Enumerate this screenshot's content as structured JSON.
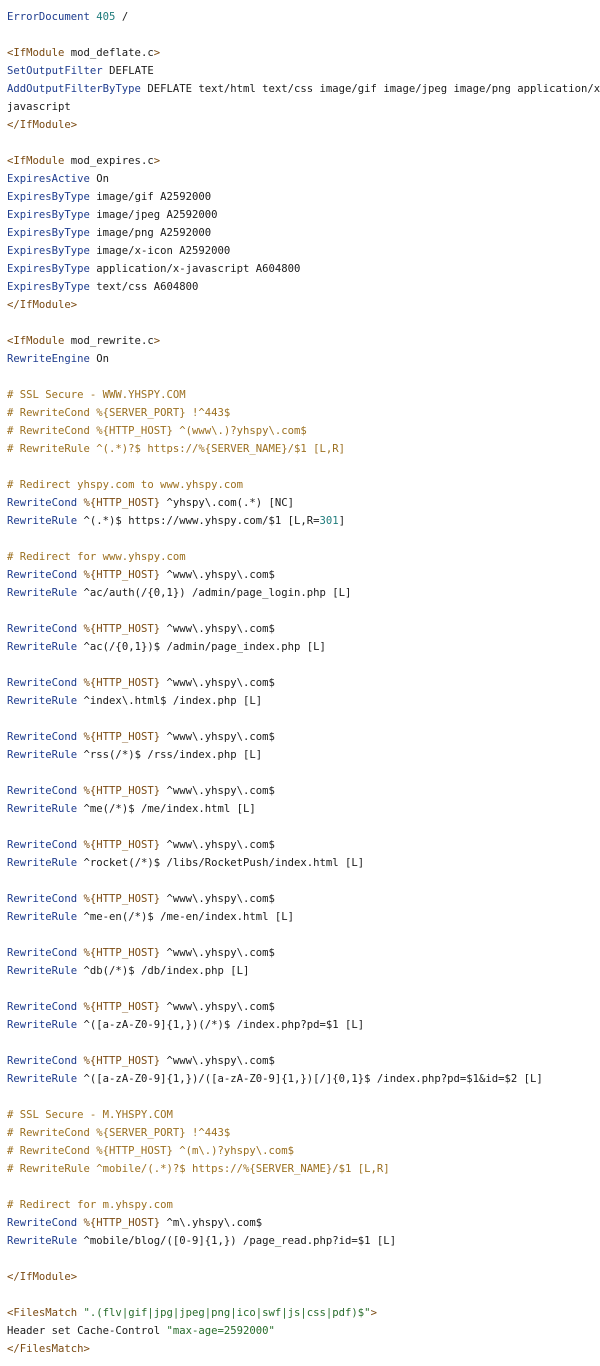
{
  "file": {
    "lines": [
      [
        {
          "t": "ErrorDocument ",
          "c": "directive"
        },
        {
          "t": "405",
          "c": "num"
        },
        {
          "t": " /",
          "c": "plain"
        }
      ],
      [],
      [
        {
          "t": "<IfModule ",
          "c": "tag"
        },
        {
          "t": "mod_deflate.c",
          "c": "plain"
        },
        {
          "t": ">",
          "c": "tag"
        }
      ],
      [
        {
          "t": "SetOutputFilter ",
          "c": "directive"
        },
        {
          "t": "DEFLATE",
          "c": "plain"
        }
      ],
      [
        {
          "t": "AddOutputFilterByType ",
          "c": "directive"
        },
        {
          "t": "DEFLATE text/html text/css image/gif image/jpeg image/png application/x-",
          "c": "plain"
        }
      ],
      [
        {
          "t": "javascript",
          "c": "plain"
        }
      ],
      [
        {
          "t": "</IfModule>",
          "c": "tag"
        }
      ],
      [],
      [
        {
          "t": "<IfModule ",
          "c": "tag"
        },
        {
          "t": "mod_expires.c",
          "c": "plain"
        },
        {
          "t": ">",
          "c": "tag"
        }
      ],
      [
        {
          "t": "ExpiresActive ",
          "c": "directive"
        },
        {
          "t": "On",
          "c": "plain"
        }
      ],
      [
        {
          "t": "ExpiresByType ",
          "c": "directive"
        },
        {
          "t": "image/gif A2592000",
          "c": "plain"
        }
      ],
      [
        {
          "t": "ExpiresByType ",
          "c": "directive"
        },
        {
          "t": "image/jpeg A2592000",
          "c": "plain"
        }
      ],
      [
        {
          "t": "ExpiresByType ",
          "c": "directive"
        },
        {
          "t": "image/png A2592000",
          "c": "plain"
        }
      ],
      [
        {
          "t": "ExpiresByType ",
          "c": "directive"
        },
        {
          "t": "image/x-icon A2592000",
          "c": "plain"
        }
      ],
      [
        {
          "t": "ExpiresByType ",
          "c": "directive"
        },
        {
          "t": "application/x-javascript A604800",
          "c": "plain"
        }
      ],
      [
        {
          "t": "ExpiresByType ",
          "c": "directive"
        },
        {
          "t": "text/css A604800",
          "c": "plain"
        }
      ],
      [
        {
          "t": "</IfModule>",
          "c": "tag"
        }
      ],
      [],
      [
        {
          "t": "<IfModule ",
          "c": "tag"
        },
        {
          "t": "mod_rewrite.c",
          "c": "plain"
        },
        {
          "t": ">",
          "c": "tag"
        }
      ],
      [
        {
          "t": "RewriteEngine ",
          "c": "directive"
        },
        {
          "t": "On",
          "c": "plain"
        }
      ],
      [],
      [
        {
          "t": "# SSL Secure - WWW.YHSPY.COM",
          "c": "comment"
        }
      ],
      [
        {
          "t": "# RewriteCond %{SERVER_PORT} !^443$",
          "c": "comment"
        }
      ],
      [
        {
          "t": "# RewriteCond %{HTTP_HOST} ^(www\\.)?yhspy\\.com$",
          "c": "comment"
        }
      ],
      [
        {
          "t": "# RewriteRule ^(.*)?$ https://%{SERVER_NAME}/$1 [L,R]",
          "c": "comment"
        }
      ],
      [],
      [
        {
          "t": "# Redirect yhspy.com to www.yhspy.com",
          "c": "comment"
        }
      ],
      [
        {
          "t": "RewriteCond ",
          "c": "directive"
        },
        {
          "t": "%{HTTP_HOST}",
          "c": "tag"
        },
        {
          "t": " ^yhspy\\.com(.*) [NC]",
          "c": "plain"
        }
      ],
      [
        {
          "t": "RewriteRule ",
          "c": "directive"
        },
        {
          "t": "^(.*)$ https://www.yhspy.com/$1 [L,R=",
          "c": "plain"
        },
        {
          "t": "301",
          "c": "num"
        },
        {
          "t": "]",
          "c": "plain"
        }
      ],
      [],
      [
        {
          "t": "# Redirect for www.yhspy.com",
          "c": "comment"
        }
      ],
      [
        {
          "t": "RewriteCond ",
          "c": "directive"
        },
        {
          "t": "%{HTTP_HOST}",
          "c": "tag"
        },
        {
          "t": " ^www\\.yhspy\\.com$",
          "c": "plain"
        }
      ],
      [
        {
          "t": "RewriteRule ",
          "c": "directive"
        },
        {
          "t": "^ac/auth(/{0,1}) /admin/page_login.php [L]",
          "c": "plain"
        }
      ],
      [],
      [
        {
          "t": "RewriteCond ",
          "c": "directive"
        },
        {
          "t": "%{HTTP_HOST}",
          "c": "tag"
        },
        {
          "t": " ^www\\.yhspy\\.com$",
          "c": "plain"
        }
      ],
      [
        {
          "t": "RewriteRule ",
          "c": "directive"
        },
        {
          "t": "^ac(/{0,1})$ /admin/page_index.php [L]",
          "c": "plain"
        }
      ],
      [],
      [
        {
          "t": "RewriteCond ",
          "c": "directive"
        },
        {
          "t": "%{HTTP_HOST}",
          "c": "tag"
        },
        {
          "t": " ^www\\.yhspy\\.com$",
          "c": "plain"
        }
      ],
      [
        {
          "t": "RewriteRule ",
          "c": "directive"
        },
        {
          "t": "^index\\.html$ /index.php [L]",
          "c": "plain"
        }
      ],
      [],
      [
        {
          "t": "RewriteCond ",
          "c": "directive"
        },
        {
          "t": "%{HTTP_HOST}",
          "c": "tag"
        },
        {
          "t": " ^www\\.yhspy\\.com$",
          "c": "plain"
        }
      ],
      [
        {
          "t": "RewriteRule ",
          "c": "directive"
        },
        {
          "t": "^rss(/*)$ /rss/index.php [L]",
          "c": "plain"
        }
      ],
      [],
      [
        {
          "t": "RewriteCond ",
          "c": "directive"
        },
        {
          "t": "%{HTTP_HOST}",
          "c": "tag"
        },
        {
          "t": " ^www\\.yhspy\\.com$",
          "c": "plain"
        }
      ],
      [
        {
          "t": "RewriteRule ",
          "c": "directive"
        },
        {
          "t": "^me(/*)$ /me/index.html [L]",
          "c": "plain"
        }
      ],
      [],
      [
        {
          "t": "RewriteCond ",
          "c": "directive"
        },
        {
          "t": "%{HTTP_HOST}",
          "c": "tag"
        },
        {
          "t": " ^www\\.yhspy\\.com$",
          "c": "plain"
        }
      ],
      [
        {
          "t": "RewriteRule ",
          "c": "directive"
        },
        {
          "t": "^rocket(/*)$ /libs/RocketPush/index.html [L]",
          "c": "plain"
        }
      ],
      [],
      [
        {
          "t": "RewriteCond ",
          "c": "directive"
        },
        {
          "t": "%{HTTP_HOST}",
          "c": "tag"
        },
        {
          "t": " ^www\\.yhspy\\.com$",
          "c": "plain"
        }
      ],
      [
        {
          "t": "RewriteRule ",
          "c": "directive"
        },
        {
          "t": "^me-en(/*)$ /me-en/index.html [L]",
          "c": "plain"
        }
      ],
      [],
      [
        {
          "t": "RewriteCond ",
          "c": "directive"
        },
        {
          "t": "%{HTTP_HOST}",
          "c": "tag"
        },
        {
          "t": " ^www\\.yhspy\\.com$",
          "c": "plain"
        }
      ],
      [
        {
          "t": "RewriteRule ",
          "c": "directive"
        },
        {
          "t": "^db(/*)$ /db/index.php [L]",
          "c": "plain"
        }
      ],
      [],
      [
        {
          "t": "RewriteCond ",
          "c": "directive"
        },
        {
          "t": "%{HTTP_HOST}",
          "c": "tag"
        },
        {
          "t": " ^www\\.yhspy\\.com$",
          "c": "plain"
        }
      ],
      [
        {
          "t": "RewriteRule ",
          "c": "directive"
        },
        {
          "t": "^([a-zA-Z0-9]{1,})(/*)$ /index.php?pd=$1 [L]",
          "c": "plain"
        }
      ],
      [],
      [
        {
          "t": "RewriteCond ",
          "c": "directive"
        },
        {
          "t": "%{HTTP_HOST}",
          "c": "tag"
        },
        {
          "t": " ^www\\.yhspy\\.com$",
          "c": "plain"
        }
      ],
      [
        {
          "t": "RewriteRule ",
          "c": "directive"
        },
        {
          "t": "^([a-zA-Z0-9]{1,})/([a-zA-Z0-9]{1,})[/]{0,1}$ /index.php?pd=$1&id=$2 [L]",
          "c": "plain"
        }
      ],
      [],
      [
        {
          "t": "# SSL Secure - M.YHSPY.COM",
          "c": "comment"
        }
      ],
      [
        {
          "t": "# RewriteCond %{SERVER_PORT} !^443$",
          "c": "comment"
        }
      ],
      [
        {
          "t": "# RewriteCond %{HTTP_HOST} ^(m\\.)?yhspy\\.com$",
          "c": "comment"
        }
      ],
      [
        {
          "t": "# RewriteRule ^mobile/(.*)?$ https://%{SERVER_NAME}/$1 [L,R]",
          "c": "comment"
        }
      ],
      [],
      [
        {
          "t": "# Redirect for m.yhspy.com",
          "c": "comment"
        }
      ],
      [
        {
          "t": "RewriteCond ",
          "c": "directive"
        },
        {
          "t": "%{HTTP_HOST}",
          "c": "tag"
        },
        {
          "t": " ^m\\.yhspy\\.com$",
          "c": "plain"
        }
      ],
      [
        {
          "t": "RewriteRule ",
          "c": "directive"
        },
        {
          "t": "^mobile/blog/([0-9]{1,}) /page_read.php?id=$1 [L]",
          "c": "plain"
        }
      ],
      [],
      [
        {
          "t": "</IfModule>",
          "c": "tag"
        }
      ],
      [],
      [
        {
          "t": "<FilesMatch ",
          "c": "tag"
        },
        {
          "t": "\".(flv|gif|jpg|jpeg|png|ico|swf|js|css|pdf)$\"",
          "c": "string"
        },
        {
          "t": ">",
          "c": "tag"
        }
      ],
      [
        {
          "t": "Header set Cache-Control ",
          "c": "plain"
        },
        {
          "t": "\"max-age=2592000\"",
          "c": "string"
        }
      ],
      [
        {
          "t": "</FilesMatch>",
          "c": "tag"
        }
      ]
    ]
  }
}
